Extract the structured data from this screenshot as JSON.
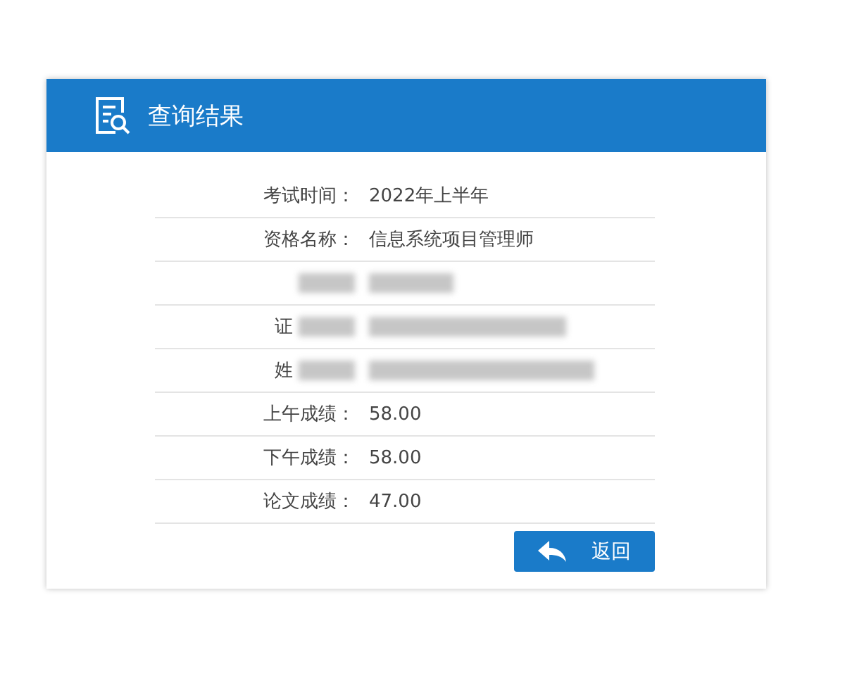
{
  "header": {
    "title": "查询结果"
  },
  "rows": [
    {
      "label": "考试时间：",
      "value": "2022年上半年",
      "redacted": false
    },
    {
      "label": "资格名称：",
      "value": "信息系统项目管理师",
      "redacted": false
    },
    {
      "redacted": true
    },
    {
      "label": "证",
      "redacted": true
    },
    {
      "label": "姓",
      "redacted": true
    },
    {
      "label": "上午成绩：",
      "value": "58.00",
      "redacted": false
    },
    {
      "label": "下午成绩：",
      "value": "58.00",
      "redacted": false
    },
    {
      "label": "论文成绩：",
      "value": "47.00",
      "redacted": false
    }
  ],
  "back_button": {
    "label": "返回"
  }
}
